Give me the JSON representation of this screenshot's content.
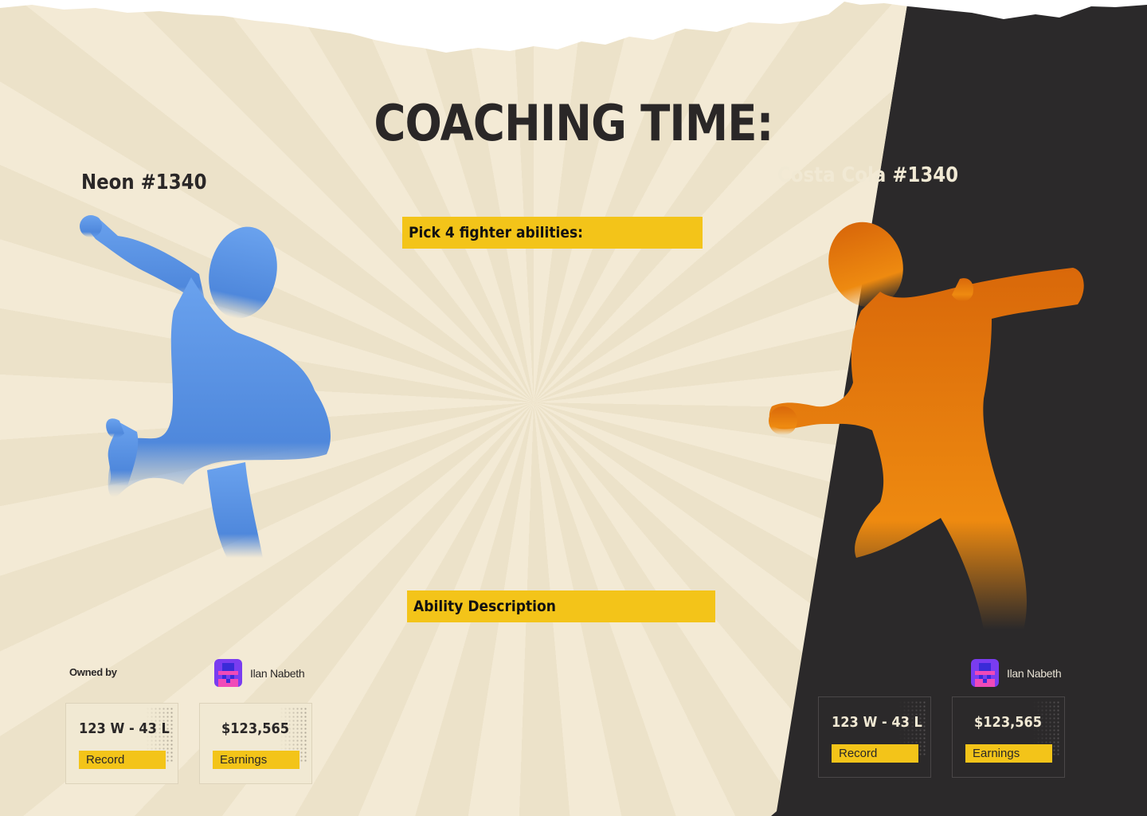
{
  "page": {
    "heading": "COACHING TIME:",
    "colors": {
      "cream": "#f3ead5",
      "dark": "#2b292a",
      "accent_yellow": "#f3c419",
      "blue_fighter": "#5e96e6",
      "orange_fighter": "#ee8a10"
    }
  },
  "left_fighter": {
    "name": "Neon #1340",
    "owned_by_label": "Owned by",
    "owner_name": "Ilan Nabeth",
    "record": "123 W - 43 L",
    "record_label": "Record",
    "earnings": "$123,565",
    "earnings_label": "Earnings",
    "figure_icon": "blue-fighter-figure"
  },
  "right_fighter": {
    "name": "Costa Cola #1340",
    "owner_name": "Ilan Nabeth",
    "record": "123 W - 43 L",
    "record_label": "Record",
    "earnings": "$123,565",
    "earnings_label": "Earnings",
    "figure_icon": "orange-fighter-figure"
  },
  "abilities": {
    "pick_label": "Pick 4 fighter abilities:",
    "description_label": "Ability Description"
  }
}
